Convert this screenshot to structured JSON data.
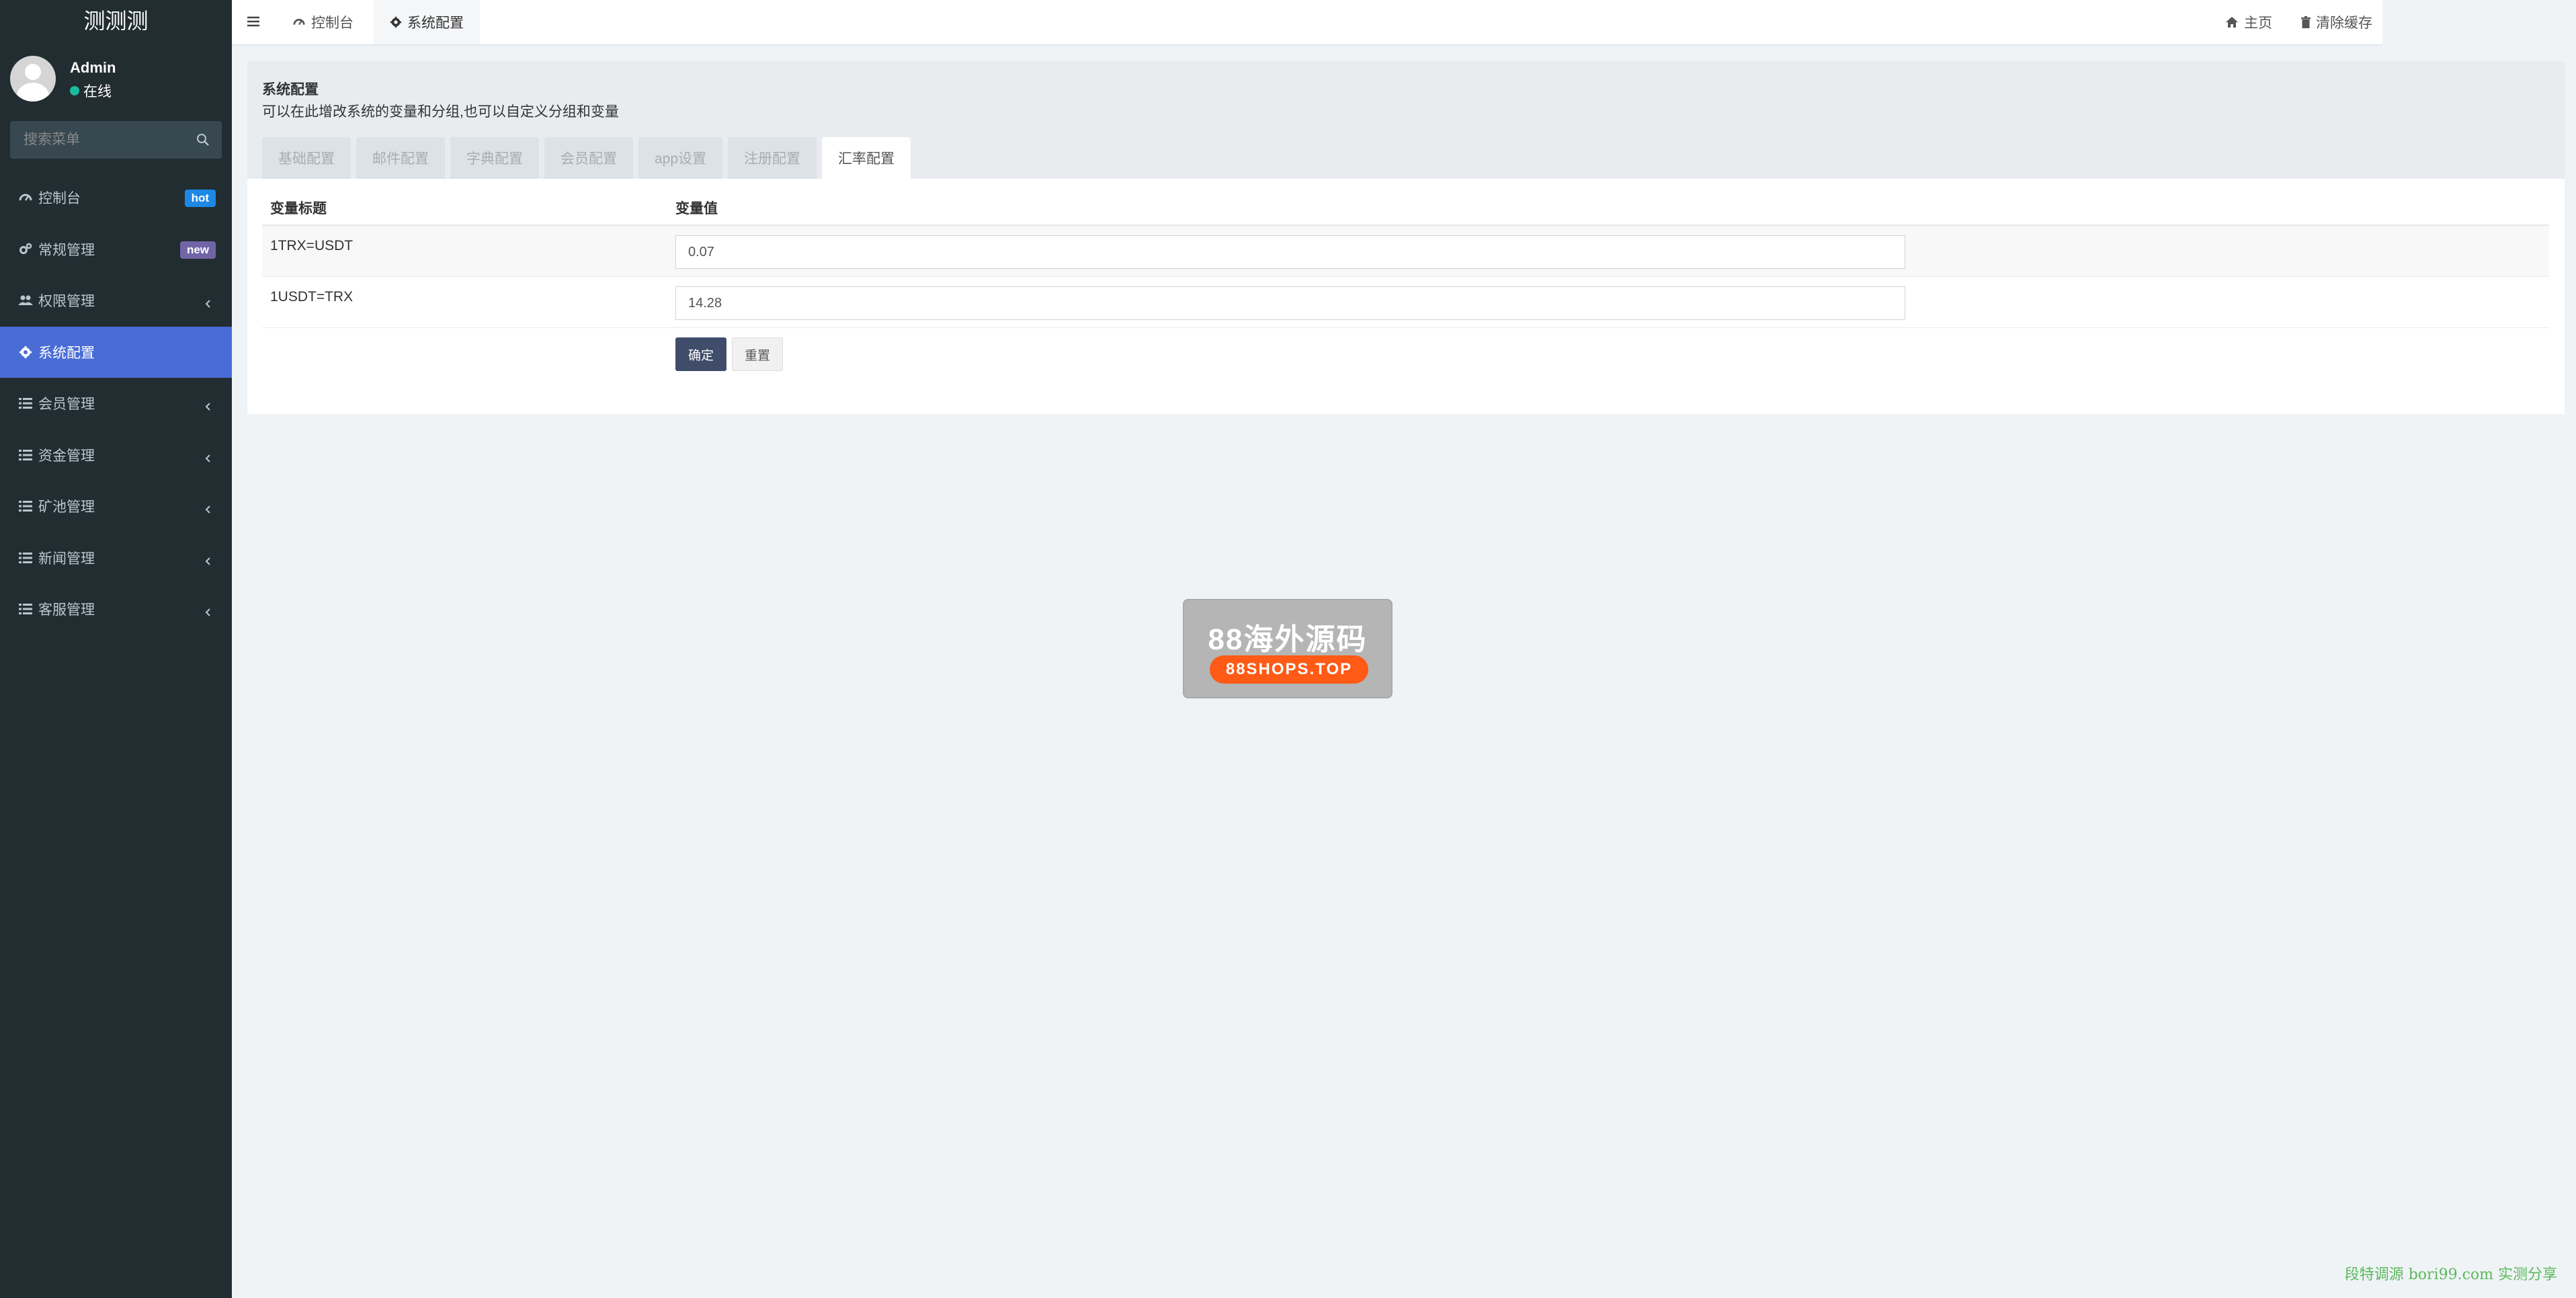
{
  "app": {
    "brand": "测测测"
  },
  "user": {
    "name": "Admin",
    "status": "在线"
  },
  "search": {
    "placeholder": "搜索菜单"
  },
  "menu": [
    {
      "label": "控制台",
      "icon": "dashboard-icon",
      "badge": "hot"
    },
    {
      "label": "常规管理",
      "icon": "cogs-icon",
      "badge": "new"
    },
    {
      "label": "权限管理",
      "icon": "users-icon"
    },
    {
      "label": "系统配置",
      "icon": "gear-icon",
      "active": true
    },
    {
      "label": "会员管理",
      "icon": "list-icon"
    },
    {
      "label": "资金管理",
      "icon": "list-icon"
    },
    {
      "label": "矿池管理",
      "icon": "list-icon"
    },
    {
      "label": "新闻管理",
      "icon": "list-icon"
    },
    {
      "label": "客服管理",
      "icon": "list-icon"
    }
  ],
  "topbar": {
    "tabs": [
      {
        "label": "控制台",
        "icon": "dashboard-icon"
      },
      {
        "label": "系统配置",
        "icon": "gear-icon",
        "active": true
      }
    ],
    "home_label": "主页",
    "clear_cache_label": "清除缓存"
  },
  "page": {
    "title": "系统配置",
    "description": "可以在此增改系统的变量和分组,也可以自定义分组和变量",
    "tabs": [
      "基础配置",
      "邮件配置",
      "字典配置",
      "会员配置",
      "app设置",
      "注册配置",
      "汇率配置"
    ],
    "active_tab": "汇率配置"
  },
  "table": {
    "headers": {
      "title": "变量标题",
      "value": "变量值"
    },
    "rows": [
      {
        "title": "1TRX=USDT",
        "value": "0.07"
      },
      {
        "title": "1USDT=TRX",
        "value": "14.28"
      }
    ],
    "ok_label": "确定",
    "reset_label": "重置"
  },
  "watermark": {
    "title": "88海外源码",
    "subtitle": "88SHOPS.TOP"
  },
  "footer_watermark": "段特调源 bori99.com 实测分享",
  "colors": {
    "sidebar": "#222d32",
    "active_menu": "#4a6cd5",
    "hot_badge": "#1e88e5",
    "new_badge": "#7165a8",
    "ok_button": "#3f4d6b"
  }
}
